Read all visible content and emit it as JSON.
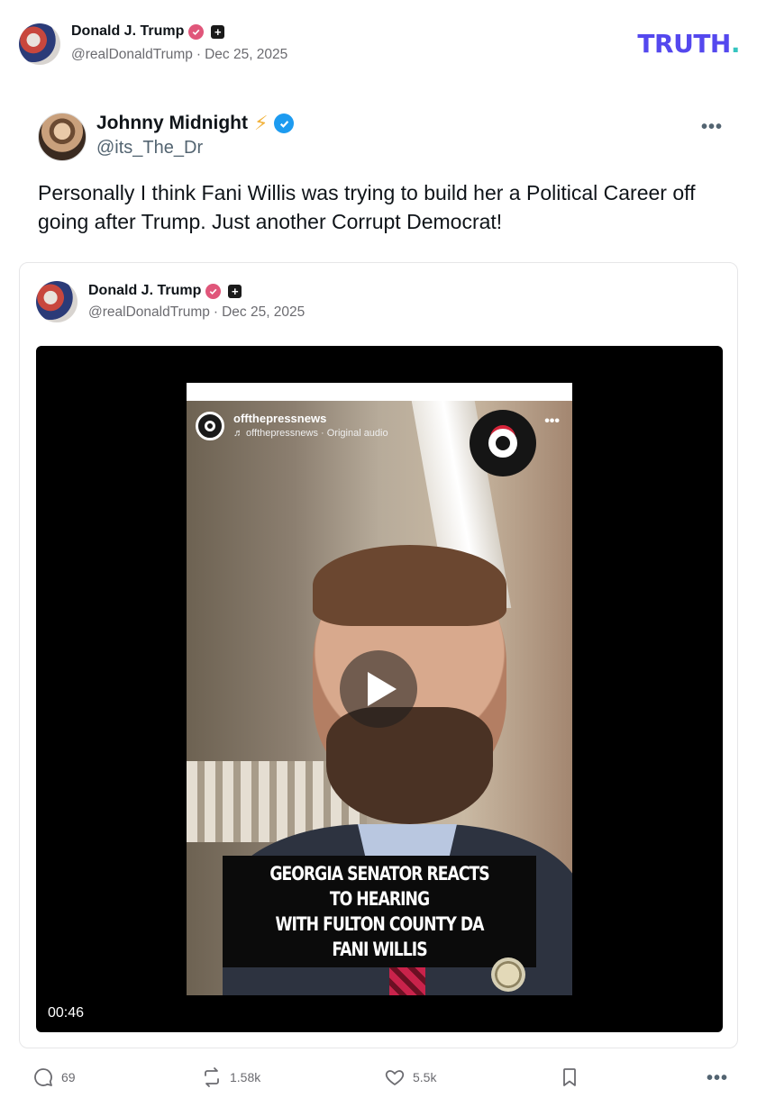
{
  "post": {
    "author_name": "Donald J. Trump",
    "handle": "@realDonaldTrump",
    "separator": "·",
    "date": "Dec 25, 2025",
    "brand_logo": "TRUTH",
    "brand_logo_dot": "."
  },
  "embedded_tweet": {
    "author_name": "Johnny Midnight",
    "emoji": "⚡",
    "handle": "@its_The_Dr",
    "more": "•••",
    "text": "Personally I think Fani Willis was trying to build her a Political Career off going after Trump. Just another Corrupt Democrat!"
  },
  "quote": {
    "author_name": "Donald J. Trump",
    "handle": "@realDonaldTrump",
    "separator": "·",
    "date": "Dec 25, 2025",
    "video": {
      "ig_account": "offthepressnews",
      "ig_sub": "♬ offthepressnews · Original audio",
      "ig_more": "•••",
      "caption_line1": "GEORGIA SENATOR REACTS TO HEARING",
      "caption_line2": "WITH FULTON COUNTY DA FANI WILLIS",
      "duration": "00:46"
    }
  },
  "actions": {
    "replies": "69",
    "retruths": "1.58k",
    "likes": "5.5k",
    "more": "•••"
  },
  "colors": {
    "brand": "#5448ee",
    "brand_dot": "#36c5c0",
    "verified": "#e0567a",
    "blue_check": "#1d9bf0"
  }
}
